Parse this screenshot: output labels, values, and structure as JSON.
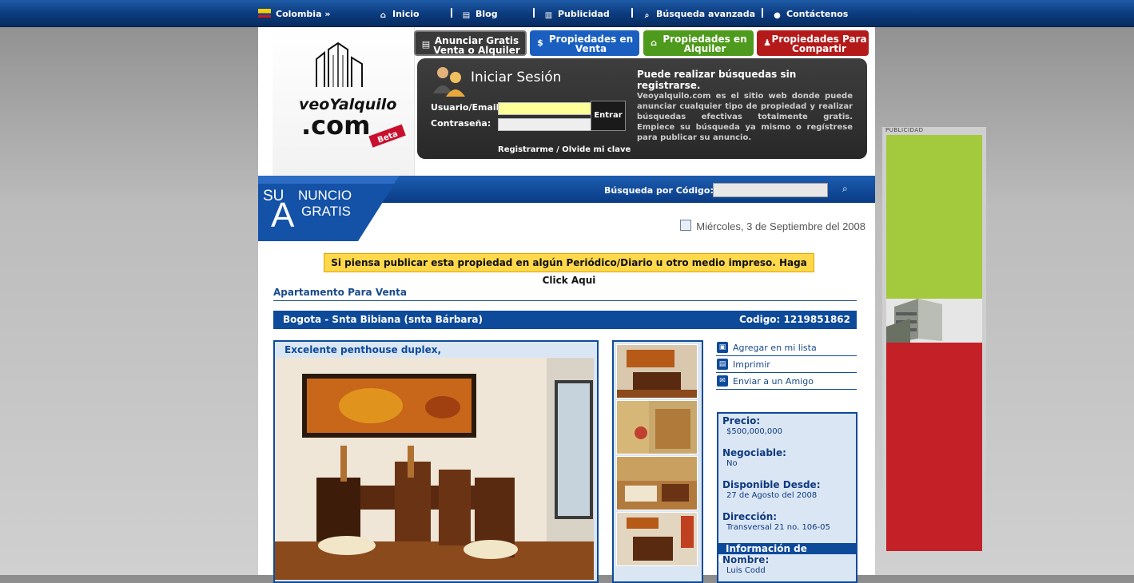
{
  "topnav": {
    "country": "Colombia »",
    "items": [
      "Inicio",
      "Blog",
      "Publicidad",
      "Búsqueda avanzada",
      "Contáctenos"
    ]
  },
  "logo": {
    "brand_top": "veoYalquilo",
    "brand_bottom": ".com",
    "badge": "Beta"
  },
  "tabs": [
    {
      "label": "Anunciar Gratis Venta o Alquiler",
      "color": "#3a3a3a"
    },
    {
      "label": "Propiedades en Venta",
      "color": "#1a5fc0"
    },
    {
      "label": "Propiedades en Alquiler",
      "color": "#4e9a1c"
    },
    {
      "label": "Propiedades Para Compartir",
      "color": "#b51a1a"
    }
  ],
  "login": {
    "title": "Iniciar Sesión",
    "user_label": "Usuario/Email:",
    "pass_label": "Contraseña:",
    "submit": "Entrar",
    "register": "Registrarme",
    "link_sep": "/",
    "forgot": "Olvide mi clave",
    "info_heading": "Puede realizar búsquedas sin registrarse.",
    "info_text": "Veoyalquilo.com es el sitio web donde puede anunciar cualquier tipo de propiedad y realizar búsquedas efectivas totalmente gratis. Empiece su búsqueda ya mismo o regístrese para publicar su anuncio."
  },
  "banner": {
    "line1": "SU",
    "line1b": "NUNCIO",
    "big": "A",
    "line2": "GRATIS"
  },
  "search": {
    "label": "Búsqueda por Código:",
    "value": ""
  },
  "date": "Miércoles, 3 de Septiembre del 2008",
  "notice": "Si piensa publicar esta propiedad en algún Periódico/Diario u otro medio impreso. Haga Click Aqui",
  "property": {
    "type": "Apartamento Para Venta",
    "location": "Bogota - Snta Bibiana (snta Bárbara)",
    "code_label": "Codigo: 1219851862",
    "caption": "Excelente penthouse duplex,"
  },
  "actions": [
    "Agregar en mi lista",
    "Imprimir",
    "Enviar a un Amigo"
  ],
  "details": {
    "precio_label": "Precio:",
    "precio": "$500,000,000",
    "negociable_label": "Negociable:",
    "negociable": "No",
    "disponible_label": "Disponible Desde:",
    "disponible": "27 de Agosto del 2008",
    "direccion_label": "Dirección:",
    "direccion": "Transversal 21 no. 106-05",
    "contact_header": "Información de Contacto",
    "nombre_label": "Nombre:",
    "nombre": "Luis Codd"
  },
  "ad": {
    "label": "PUBLICIDAD"
  }
}
